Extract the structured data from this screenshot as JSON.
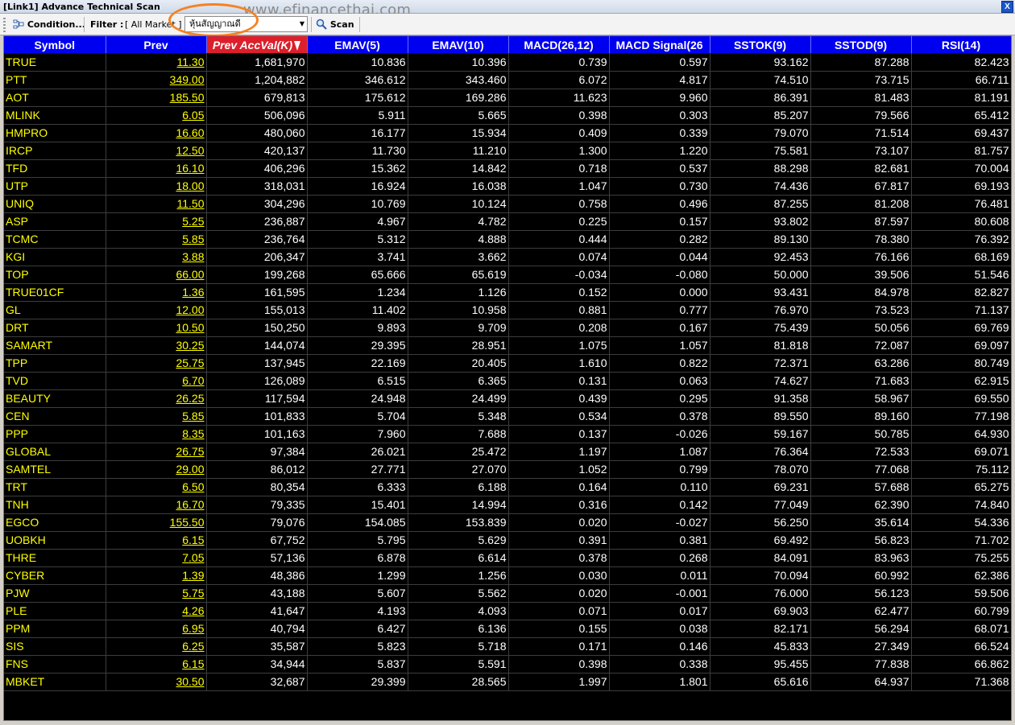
{
  "window": {
    "title": "[Link1] Advance Technical Scan",
    "close_label": "X"
  },
  "watermark": "www.efinancethai.com",
  "toolbar": {
    "condition_label": "Condition...",
    "filter_label": "Filter :",
    "filter_value": "[ All Market ]",
    "combo_value": "หุ้นสัญญาณดี",
    "scan_label": "Scan"
  },
  "colors": {
    "header_bg": "#0000f0",
    "sorted_header_bg": "#dc1f2b",
    "symbol_text": "#ffff00",
    "grid_bg": "#000000",
    "highlight_oval": "#f58220"
  },
  "table": {
    "columns": [
      "Symbol",
      "Prev",
      "Prev AccVal(K)",
      "EMAV(5)",
      "EMAV(10)",
      "MACD(26,12)",
      "MACD Signal(26",
      "SSTOK(9)",
      "SSTOD(9)",
      "RSI(14)"
    ],
    "rows": [
      [
        "TRUE",
        "11.30",
        "1,681,970",
        "10.836",
        "10.396",
        "0.739",
        "0.597",
        "93.162",
        "87.288",
        "82.423"
      ],
      [
        "PTT",
        "349.00",
        "1,204,882",
        "346.612",
        "343.460",
        "6.072",
        "4.817",
        "74.510",
        "73.715",
        "66.711"
      ],
      [
        "AOT",
        "185.50",
        "679,813",
        "175.612",
        "169.286",
        "11.623",
        "9.960",
        "86.391",
        "81.483",
        "81.191"
      ],
      [
        "MLINK",
        "6.05",
        "506,096",
        "5.911",
        "5.665",
        "0.398",
        "0.303",
        "85.207",
        "79.566",
        "65.412"
      ],
      [
        "HMPRO",
        "16.60",
        "480,060",
        "16.177",
        "15.934",
        "0.409",
        "0.339",
        "79.070",
        "71.514",
        "69.437"
      ],
      [
        "IRCP",
        "12.50",
        "420,137",
        "11.730",
        "11.210",
        "1.300",
        "1.220",
        "75.581",
        "73.107",
        "81.757"
      ],
      [
        "TFD",
        "16.10",
        "406,296",
        "15.362",
        "14.842",
        "0.718",
        "0.537",
        "88.298",
        "82.681",
        "70.004"
      ],
      [
        "UTP",
        "18.00",
        "318,031",
        "16.924",
        "16.038",
        "1.047",
        "0.730",
        "74.436",
        "67.817",
        "69.193"
      ],
      [
        "UNIQ",
        "11.50",
        "304,296",
        "10.769",
        "10.124",
        "0.758",
        "0.496",
        "87.255",
        "81.208",
        "76.481"
      ],
      [
        "ASP",
        "5.25",
        "236,887",
        "4.967",
        "4.782",
        "0.225",
        "0.157",
        "93.802",
        "87.597",
        "80.608"
      ],
      [
        "TCMC",
        "5.85",
        "236,764",
        "5.312",
        "4.888",
        "0.444",
        "0.282",
        "89.130",
        "78.380",
        "76.392"
      ],
      [
        "KGI",
        "3.88",
        "206,347",
        "3.741",
        "3.662",
        "0.074",
        "0.044",
        "92.453",
        "76.166",
        "68.169"
      ],
      [
        "TOP",
        "66.00",
        "199,268",
        "65.666",
        "65.619",
        "-0.034",
        "-0.080",
        "50.000",
        "39.506",
        "51.546"
      ],
      [
        "TRUE01CF",
        "1.36",
        "161,595",
        "1.234",
        "1.126",
        "0.152",
        "0.000",
        "93.431",
        "84.978",
        "82.827"
      ],
      [
        "GL",
        "12.00",
        "155,013",
        "11.402",
        "10.958",
        "0.881",
        "0.777",
        "76.970",
        "73.523",
        "71.137"
      ],
      [
        "DRT",
        "10.50",
        "150,250",
        "9.893",
        "9.709",
        "0.208",
        "0.167",
        "75.439",
        "50.056",
        "69.769"
      ],
      [
        "SAMART",
        "30.25",
        "144,074",
        "29.395",
        "28.951",
        "1.075",
        "1.057",
        "81.818",
        "72.087",
        "69.097"
      ],
      [
        "TPP",
        "25.75",
        "137,945",
        "22.169",
        "20.405",
        "1.610",
        "0.822",
        "72.371",
        "63.286",
        "80.749"
      ],
      [
        "TVD",
        "6.70",
        "126,089",
        "6.515",
        "6.365",
        "0.131",
        "0.063",
        "74.627",
        "71.683",
        "62.915"
      ],
      [
        "BEAUTY",
        "26.25",
        "117,594",
        "24.948",
        "24.499",
        "0.439",
        "0.295",
        "91.358",
        "58.967",
        "69.550"
      ],
      [
        "CEN",
        "5.85",
        "101,833",
        "5.704",
        "5.348",
        "0.534",
        "0.378",
        "89.550",
        "89.160",
        "77.198"
      ],
      [
        "PPP",
        "8.35",
        "101,163",
        "7.960",
        "7.688",
        "0.137",
        "-0.026",
        "59.167",
        "50.785",
        "64.930"
      ],
      [
        "GLOBAL",
        "26.75",
        "97,384",
        "26.021",
        "25.472",
        "1.197",
        "1.087",
        "76.364",
        "72.533",
        "69.071"
      ],
      [
        "SAMTEL",
        "29.00",
        "86,012",
        "27.771",
        "27.070",
        "1.052",
        "0.799",
        "78.070",
        "77.068",
        "75.112"
      ],
      [
        "TRT",
        "6.50",
        "80,354",
        "6.333",
        "6.188",
        "0.164",
        "0.110",
        "69.231",
        "57.688",
        "65.275"
      ],
      [
        "TNH",
        "16.70",
        "79,335",
        "15.401",
        "14.994",
        "0.316",
        "0.142",
        "77.049",
        "62.390",
        "74.840"
      ],
      [
        "EGCO",
        "155.50",
        "79,076",
        "154.085",
        "153.839",
        "0.020",
        "-0.027",
        "56.250",
        "35.614",
        "54.336"
      ],
      [
        "UOBKH",
        "6.15",
        "67,752",
        "5.795",
        "5.629",
        "0.391",
        "0.381",
        "69.492",
        "56.823",
        "71.702"
      ],
      [
        "THRE",
        "7.05",
        "57,136",
        "6.878",
        "6.614",
        "0.378",
        "0.268",
        "84.091",
        "83.963",
        "75.255"
      ],
      [
        "CYBER",
        "1.39",
        "48,386",
        "1.299",
        "1.256",
        "0.030",
        "0.011",
        "70.094",
        "60.992",
        "62.386"
      ],
      [
        "PJW",
        "5.75",
        "43,188",
        "5.607",
        "5.562",
        "0.020",
        "-0.001",
        "76.000",
        "56.123",
        "59.506"
      ],
      [
        "PLE",
        "4.26",
        "41,647",
        "4.193",
        "4.093",
        "0.071",
        "0.017",
        "69.903",
        "62.477",
        "60.799"
      ],
      [
        "PPM",
        "6.95",
        "40,794",
        "6.427",
        "6.136",
        "0.155",
        "0.038",
        "82.171",
        "56.294",
        "68.071"
      ],
      [
        "SIS",
        "6.25",
        "35,587",
        "5.823",
        "5.718",
        "0.171",
        "0.146",
        "45.833",
        "27.349",
        "66.524"
      ],
      [
        "FNS",
        "6.15",
        "34,944",
        "5.837",
        "5.591",
        "0.398",
        "0.338",
        "95.455",
        "77.838",
        "66.862"
      ],
      [
        "MBKET",
        "30.50",
        "32,687",
        "29.399",
        "28.565",
        "1.997",
        "1.801",
        "65.616",
        "64.937",
        "71.368"
      ]
    ]
  }
}
